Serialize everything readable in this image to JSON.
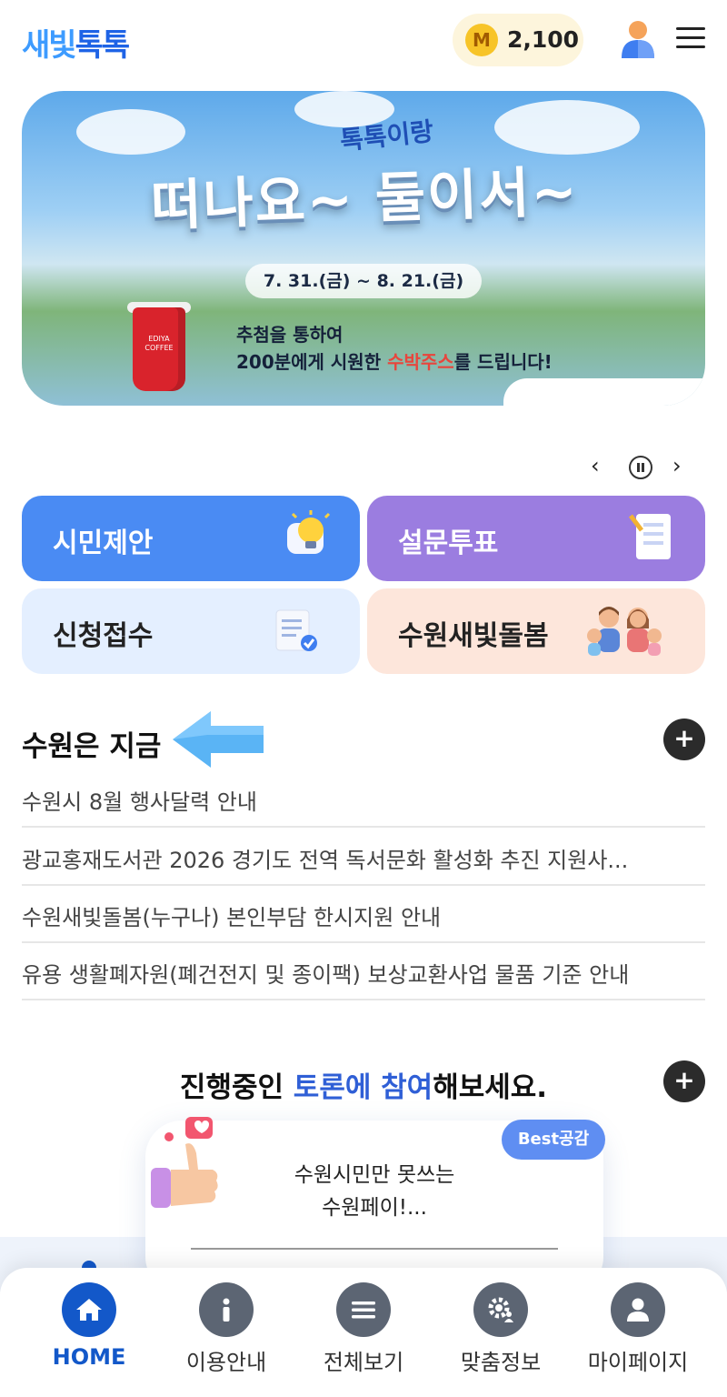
{
  "header": {
    "logo_part1": "새빛",
    "logo_part2": "톡톡",
    "points_coin": "M",
    "points_value": "2,100"
  },
  "banner": {
    "subtitle": "톡톡이랑",
    "title": "떠나요~ 둘이서~",
    "date_range": "7. 31.(금) ~ 8. 21.(금)",
    "line1": "추첨을 통하여",
    "line2_pre": "200분에게 시원한 ",
    "line2_highlight": "수박주스",
    "line2_post": "를 드립니다!",
    "cup_brand": "EDIYA COFFEE"
  },
  "carousel": {
    "prev": "‹",
    "next": "›"
  },
  "tiles": [
    {
      "label": "시민제안"
    },
    {
      "label": "설문투표"
    },
    {
      "label": "신청접수"
    },
    {
      "label": "수원새빛돌봄"
    }
  ],
  "news": {
    "title": "수원은 지금",
    "more": "+",
    "items": [
      "수원시 8월 행사달력 안내",
      "광교홍재도서관 2026 경기도 전역 독서문화 활성화 추진 지원사...",
      "수원새빛돌봄(누구나) 본인부담 한시지원 안내",
      "유용 생활폐자원(폐건전지 및 종이팩) 보상교환사업 물품 기준 안내"
    ]
  },
  "debate": {
    "title_pre": "진행중인 ",
    "title_blue": "토론에 참여",
    "title_post": "해보세요.",
    "more": "+",
    "badge": "Best공감",
    "question_line1": "수원시민만 못쓰는",
    "question_line2": "수원페이!..."
  },
  "nav": [
    {
      "label": "HOME"
    },
    {
      "label": "이용안내"
    },
    {
      "label": "전체보기"
    },
    {
      "label": "맞춤정보"
    },
    {
      "label": "마이페이지"
    }
  ],
  "colors": {
    "primary": "#1358c9",
    "tile_blue": "#4a8bf3",
    "tile_purple": "#9b7de0",
    "tile_lightblue": "#e4efff",
    "tile_peach": "#fde6db",
    "highlight_red": "#e8453c"
  }
}
